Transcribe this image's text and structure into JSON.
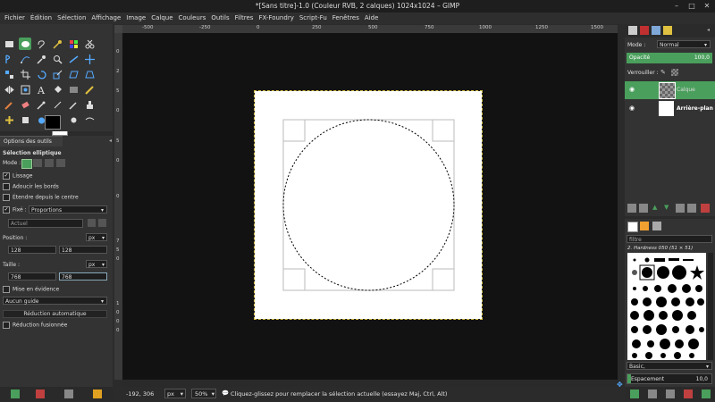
{
  "window": {
    "title": "*[Sans titre]-1.0 (Couleur RVB, 2 calques) 1024x1024 – GIMP",
    "controls": [
      "–",
      "□",
      "✕"
    ]
  },
  "menubar": [
    "Fichier",
    "Édition",
    "Sélection",
    "Affichage",
    "Image",
    "Calque",
    "Couleurs",
    "Outils",
    "Filtres",
    "FX-Foundry",
    "Script-Fu",
    "Fenêtres",
    "Aide"
  ],
  "tool_options": {
    "tab_label": "Options des outils",
    "tool_name": "Sélection elliptique",
    "mode_label": "Mode :",
    "antialias": "Lissage",
    "feather": "Adoucir les bords",
    "expand_center": "Étendre depuis le centre",
    "fixed_label": "Fixé :",
    "fixed_value": "Proportions",
    "current_value": "Actuel",
    "position_label": "Position :",
    "position_unit": "px",
    "pos_x": "128",
    "pos_y": "128",
    "size_label": "Taille :",
    "size_unit": "px",
    "size_w": "768",
    "size_h": "768",
    "highlight": "Mise en évidence",
    "guide": "Aucun guide",
    "auto_shrink": "Réduction automatique",
    "merged_shrink": "Réduction fusionnée"
  },
  "rulers": {
    "h_ticks": [
      "-500",
      "-250",
      "0",
      "250",
      "500",
      "750",
      "1000",
      "1250",
      "1500"
    ],
    "v_ticks": [
      "0",
      "2",
      "5",
      "0",
      "5",
      "0",
      "0",
      "7",
      "5",
      "0",
      "1",
      "0",
      "0",
      "0"
    ]
  },
  "statusbar": {
    "coords": "-192, 306",
    "unit": "px",
    "zoom": "50%",
    "message": "Cliquez-glissez pour remplacer la sélection actuelle (essayez Maj, Ctrl, Alt)"
  },
  "layers": {
    "mode_label": "Mode :",
    "mode_value": "Normal",
    "opacity_label": "Opacité",
    "opacity_value": "100,0",
    "lock_label": "Verrouiller :",
    "items": [
      {
        "name": "Calque"
      },
      {
        "name": "Arrière-plan"
      }
    ]
  },
  "brushes": {
    "filter_label": "filtre",
    "brush_name": "2. Hardness 050 (51 × 51)",
    "preset": "Basic,",
    "spacing_label": "Espacement",
    "spacing_value": "10,0"
  },
  "colors": {
    "accent": "#4a9f5c",
    "canvas_bg": "#121212",
    "panel_bg": "#333333"
  }
}
